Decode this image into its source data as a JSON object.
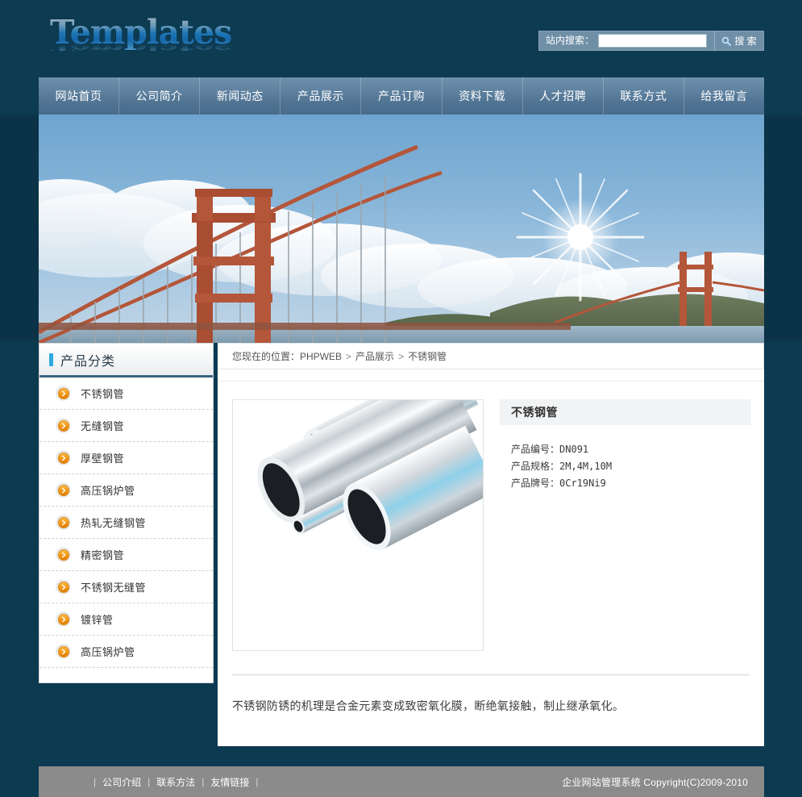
{
  "site": {
    "logo_text": "Templates"
  },
  "search": {
    "label": "站内搜索：",
    "value": "",
    "placeholder": "",
    "button_label": "搜 索",
    "icon": "search-icon"
  },
  "nav": {
    "items": [
      {
        "label": "网站首页"
      },
      {
        "label": "公司简介"
      },
      {
        "label": "新闻动态"
      },
      {
        "label": "产品展示"
      },
      {
        "label": "产品订购"
      },
      {
        "label": "资料下载"
      },
      {
        "label": "人才招聘"
      },
      {
        "label": "联系方式"
      },
      {
        "label": "给我留言"
      }
    ]
  },
  "banner": {
    "alt": "golden-gate-bridge-banner"
  },
  "sidebar": {
    "title": "产品分类",
    "items": [
      {
        "label": "不锈钢管"
      },
      {
        "label": "无缝钢管"
      },
      {
        "label": "厚壁钢管"
      },
      {
        "label": "高压锅炉管"
      },
      {
        "label": "热轧无缝钢管"
      },
      {
        "label": "精密钢管"
      },
      {
        "label": "不锈钢无缝管"
      },
      {
        "label": "镀锌管"
      },
      {
        "label": "高压锅炉管"
      }
    ]
  },
  "breadcrumb": {
    "prefix": "您现在的位置：",
    "items": [
      {
        "label": "PHPWEB"
      },
      {
        "label": "产品展示"
      },
      {
        "label": "不锈钢管"
      }
    ],
    "separator": ">"
  },
  "product": {
    "title": "不锈钢管",
    "image_alt": "stainless-steel-pipes-photo",
    "specs": [
      {
        "label": "产品编号：",
        "value": "DN091"
      },
      {
        "label": "产品规格：",
        "value": "2M,4M,10M"
      },
      {
        "label": "产品牌号：",
        "value": "0Cr19Ni9"
      }
    ],
    "description": "不锈钢防锈的机理是合金元素变成致密氧化膜，断绝氧接触，制止继承氧化。"
  },
  "footer": {
    "links": [
      {
        "label": "公司介绍"
      },
      {
        "label": "联系方法"
      },
      {
        "label": "友情链接"
      }
    ],
    "copyright": "企业网站管理系统  Copyright(C)2009-2010"
  },
  "colors": {
    "page_bg": "#0d3b52",
    "nav_bg": "#5d809e",
    "accent": "#2ea8e0",
    "bullet": "#f39c1a",
    "footer_bg": "#8b8b8b",
    "sidebar_rule": "#3b6580"
  }
}
